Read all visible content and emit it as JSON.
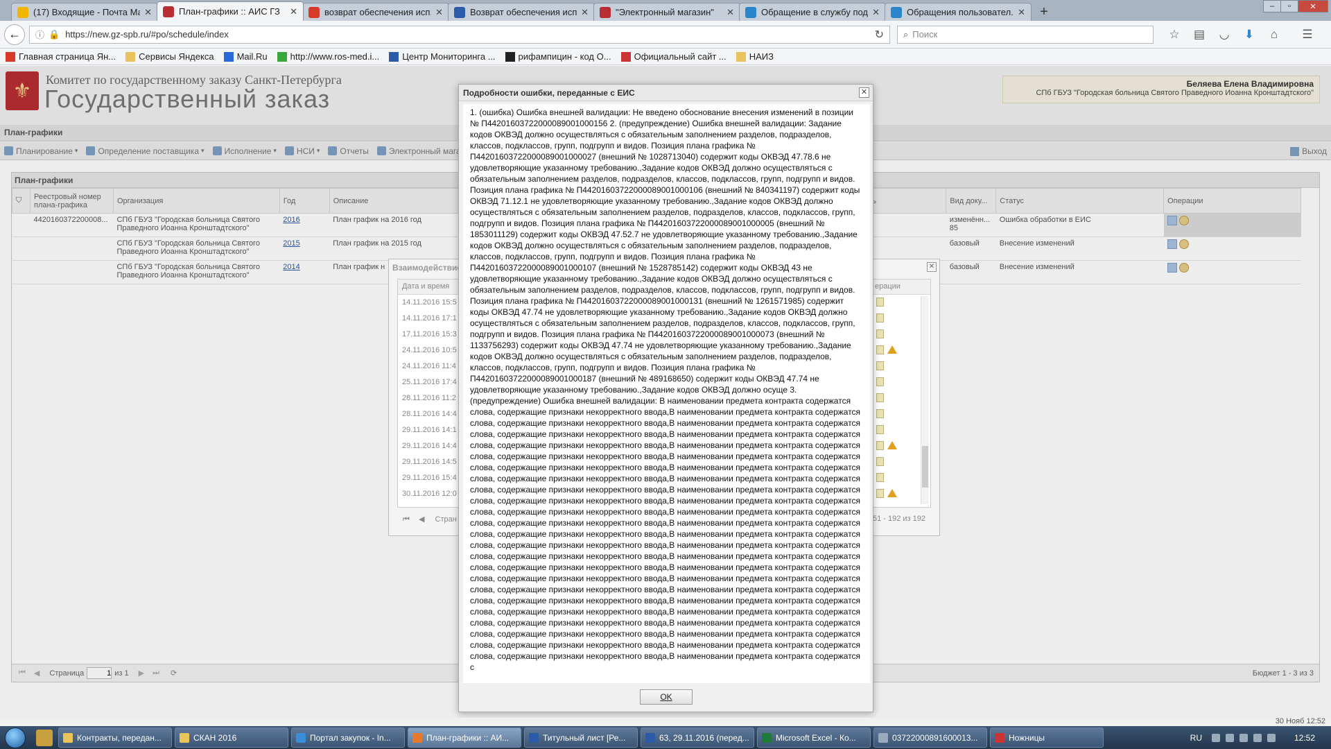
{
  "browser": {
    "tabs": [
      {
        "label": "(17) Входящие - Почта Ма...",
        "icon": "mail-icon",
        "color": "#f2b500",
        "active": false
      },
      {
        "label": "План-графики :: АИС ГЗ",
        "icon": "coat-of-arms-icon",
        "color": "#b82e33",
        "active": true
      },
      {
        "label": "возврат обеспечения исп...",
        "icon": "yandex-icon",
        "color": "#d83a2a",
        "active": false
      },
      {
        "label": "Возврат обеспечения исп...",
        "icon": "bz-icon",
        "color": "#2d5ca8",
        "active": false
      },
      {
        "label": "\"Электронный магазин\"",
        "icon": "coat-of-arms-icon",
        "color": "#b82e33",
        "active": false
      },
      {
        "label": "Обращение в службу под...",
        "icon": "globe-icon",
        "color": "#2a86c8",
        "active": false
      },
      {
        "label": "Обращения пользовател...",
        "icon": "globe-icon",
        "color": "#2a86c8",
        "active": false
      }
    ],
    "url": "https://new.gz-spb.ru/#po/schedule/index",
    "search_placeholder": "Поиск",
    "bookmarks": [
      {
        "label": "Главная страница Ян...",
        "icon": "yandex-icon"
      },
      {
        "label": "Сервисы Яндекса",
        "icon": "folder-icon"
      },
      {
        "label": "Mail.Ru",
        "icon": "mailru-icon"
      },
      {
        "label": "http://www.ros-med.i...",
        "icon": "leaf-icon"
      },
      {
        "label": "Центр Мониторинга ...",
        "icon": "chart-icon"
      },
      {
        "label": "рифампицин - код О...",
        "icon": "ru-icon"
      },
      {
        "label": "Официальный сайт ...",
        "icon": "seal-icon"
      },
      {
        "label": "НАИЗ",
        "icon": "folder-icon"
      }
    ]
  },
  "app": {
    "subtitle": "Комитет по государственному заказу Санкт-Петербурга",
    "title": "Государственный заказ",
    "user_name": "Беляева Елена Владимировна",
    "user_org": "СПб ГБУЗ \"Городская больница Святого Праведного Иоанна Кронштадтского\"",
    "section_title": "План-графики",
    "toolbar": [
      "Планирование",
      "Определение поставщика",
      "Исполнение",
      "НСИ",
      "Отчеты",
      "Электронный магазин"
    ],
    "exit_label": "Выход"
  },
  "grid": {
    "panel_title": "План-графики",
    "columns": [
      "Реестровый номер плана-графика",
      "Организация",
      "Год",
      "Описание",
      "ность",
      "Вид доку...",
      "Статус",
      "Операции"
    ],
    "rows": [
      {
        "reg": "4420160372200008...",
        "org": "СПб ГБУЗ \"Городская больница Святого Праведного Иоанна Кронштадтского\"",
        "year": "2016",
        "desc": "План график на 2016 год",
        "doc": "изменённ... 85",
        "status": "Ошибка обработки в ЕИС"
      },
      {
        "reg": "",
        "org": "СПб ГБУЗ \"Городская больница Святого Праведного Иоанна Кронштадтского\"",
        "year": "2015",
        "desc": "План график на 2015 год",
        "doc": "базовый",
        "status": "Внесение изменений"
      },
      {
        "reg": "",
        "org": "СПб ГБУЗ \"Городская больница Святого Праведного Иоанна Кронштадтского\"",
        "year": "2014",
        "desc": "План график н",
        "doc": "базовый",
        "status": "Внесение изменений"
      }
    ],
    "page_label": "Страница",
    "page_value": "1",
    "page_of": "из 1",
    "summary": "Бюджет 1 - 3 из 3"
  },
  "interaction": {
    "title": "Взаимодействие",
    "col_date": "Дата и время",
    "col_ops": "ерации",
    "dates": [
      "14.11.2016 15:5",
      "14.11.2016 17:1",
      "17.11.2016 15:3",
      "24.11.2016 10:5",
      "24.11.2016 11:4",
      "25.11.2016 17:4",
      "28.11.2016 11:2",
      "28.11.2016 14:4",
      "29.11.2016 14:1",
      "29.11.2016 14:4",
      "29.11.2016 14:5",
      "29.11.2016 15:4",
      "30.11.2016 12:0"
    ],
    "warnings": [
      false,
      false,
      false,
      true,
      false,
      false,
      false,
      false,
      false,
      true,
      false,
      false,
      true
    ],
    "page_label": "Стран",
    "range": "151 - 192 из 192"
  },
  "dialog": {
    "title": "Подробности ошибки, переданные с ЕИС",
    "text": "1. (ошибка) Ошибка внешней валидации: Не введено обоснование внесения изменений в позиции № П44201603722000089001000156 2. (предупреждение) Ошибка внешней валидации: Задание кодов ОКВЭД должно осуществляться с обязательным заполнением разделов, подразделов, классов, подклассов, групп, подгрупп и видов. Позиция плана графика № П44201603722000089001000027 (внешний № 1028713040) содержит коды ОКВЭД 47.78.6 не удовлетворяющие указанному требованию.,Задание кодов ОКВЭД должно осуществляться с обязательным заполнением разделов, подразделов, классов, подклассов, групп, подгрупп и видов. Позиция плана графика № П44201603722000089001000106 (внешний № 840341197) содержит коды ОКВЭД 71.12.1 не удовлетворяющие указанному требованию.,Задание кодов ОКВЭД должно осуществляться с обязательным заполнением разделов, подразделов, классов, подклассов, групп, подгрупп и видов. Позиция плана графика № П44201603722000089001000005 (внешний № 1853011129) содержит коды ОКВЭД 47.52.7 не удовлетворяющие указанному требованию.,Задание кодов ОКВЭД должно осуществляться с обязательным заполнением разделов, подразделов, классов, подклассов, групп, подгрупп и видов. Позиция плана графика № П44201603722000089001000107 (внешний № 1528785142) содержит коды ОКВЭД 43 не удовлетворяющие указанному требованию.,Задание кодов ОКВЭД должно осуществляться с обязательным заполнением разделов, подразделов, классов, подклассов, групп, подгрупп и видов. Позиция плана графика № П44201603722000089001000131 (внешний № 1261571985) содержит коды ОКВЭД 47.74 не удовлетворяющие указанному требованию.,Задание кодов ОКВЭД должно осуществляться с обязательным заполнением разделов, подразделов, классов, подклассов, групп, подгрупп и видов. Позиция плана графика № П44201603722000089001000073 (внешний № 1133756293) содержит коды ОКВЭД 47.74 не удовлетворяющие указанному требованию.,Задание кодов ОКВЭД должно осуществляться с обязательным заполнением разделов, подразделов, классов, подклассов, групп, подгрупп и видов. Позиция плана графика № П44201603722000089001000187 (внешний № 489168650) содержит коды ОКВЭД 47.74 не удовлетворяющие указанному требованию.,Задание кодов ОКВЭД должно осуще 3. (предупреждение) Ошибка внешней валидации: В наименовании предмета контракта содержатся слова, содержащие признаки некорректного ввода,В наименовании предмета контракта содержатся слова, содержащие признаки некорректного ввода,В наименовании предмета контракта содержатся слова, содержащие признаки некорректного ввода,В наименовании предмета контракта содержатся слова, содержащие признаки некорректного ввода,В наименовании предмета контракта содержатся слова, содержащие признаки некорректного ввода,В наименовании предмета контракта содержатся слова, содержащие признаки некорректного ввода,В наименовании предмета контракта содержатся слова, содержащие признаки некорректного ввода,В наименовании предмета контракта содержатся слова, содержащие признаки некорректного ввода,В наименовании предмета контракта содержатся слова, содержащие признаки некорректного ввода,В наименовании предмета контракта содержатся слова, содержащие признаки некорректного ввода,В наименовании предмета контракта содержатся слова, содержащие признаки некорректного ввода,В наименовании предмета контракта содержатся слова, содержащие признаки некорректного ввода,В наименовании предмета контракта содержатся слова, содержащие признаки некорректного ввода,В наименовании предмета контракта содержатся слова, содержащие признаки некорректного ввода,В наименовании предмета контракта содержатся слова, содержащие признаки некорректного ввода,В наименовании предмета контракта содержатся слова, содержащие признаки некорректного ввода,В наименовании предмета контракта содержатся слова, содержащие признаки некорректного ввода,В наименовании предмета контракта содержатся слова, содержащие признаки некорректного ввода,В наименовании предмета контракта содержатся слова, содержащие признаки некорректного ввода,В наименовании предмета контракта содержатся слова, содержащие признаки некорректного ввода,В наименовании предмета контракта содержатся слова, содержащие признаки некорректного ввода,В наименовании предмета контракта содержатся слова, содержащие признаки некорректного ввода,В наименовании предмета контракта содержатся слова, содержащие признаки некорректного ввода,В наименовании предмета контракта содержатся с",
    "ok_label": "OK"
  },
  "status": {
    "date": "30 Нояб 12:52"
  },
  "taskbar": {
    "tasks": [
      {
        "label": "Контракты, передан...",
        "icon": "folder-icon",
        "color": "#e8c45a"
      },
      {
        "label": "СКАН 2016",
        "icon": "folder-icon",
        "color": "#e8c45a"
      },
      {
        "label": "Портал закупок - In...",
        "icon": "ie-icon",
        "color": "#3a8ed8"
      },
      {
        "label": "План-графики :: АИ...",
        "icon": "firefox-icon",
        "color": "#e8782a",
        "active": true
      },
      {
        "label": "Титульный лист [Ре...",
        "icon": "word-icon",
        "color": "#2a5aa8"
      },
      {
        "label": "63, 29.11.2016 (перед...",
        "icon": "word-icon",
        "color": "#2a5aa8"
      },
      {
        "label": "Microsoft Excel - Ко...",
        "icon": "excel-icon",
        "color": "#1f7a3a"
      },
      {
        "label": "03722000891600013...",
        "icon": "window-icon",
        "color": "#9ab"
      },
      {
        "label": "Ножницы",
        "icon": "scissors-icon",
        "color": "#c33"
      }
    ],
    "lang": "RU",
    "time": "12:52"
  }
}
